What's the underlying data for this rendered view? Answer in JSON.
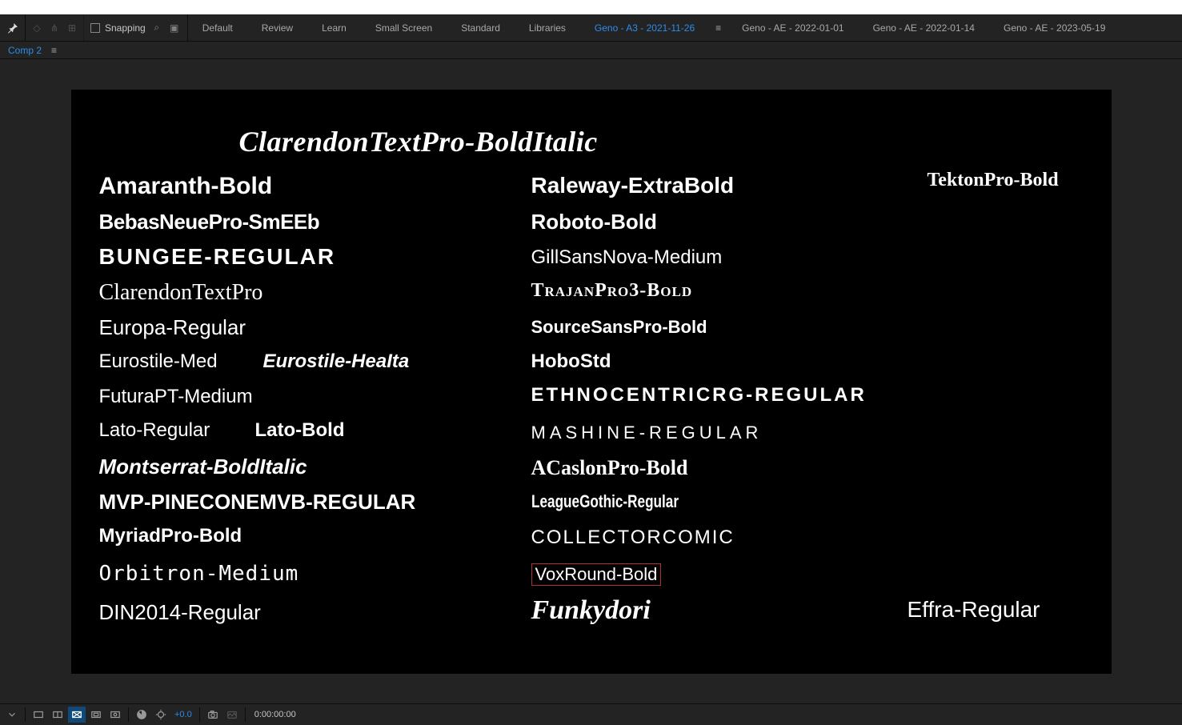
{
  "toolbar": {
    "snapping_label": "Snapping"
  },
  "workspaces": {
    "items": [
      {
        "label": "Default",
        "active": false
      },
      {
        "label": "Review",
        "active": false
      },
      {
        "label": "Learn",
        "active": false
      },
      {
        "label": "Small Screen",
        "active": false
      },
      {
        "label": "Standard",
        "active": false
      },
      {
        "label": "Libraries",
        "active": false
      },
      {
        "label": "Geno - A3 - 2021-11-26",
        "active": true
      },
      {
        "label": "Geno - AE - 2022-01-01",
        "active": false
      },
      {
        "label": "Geno - AE - 2022-01-14",
        "active": false
      },
      {
        "label": "Geno - AE - 2023-05-19",
        "active": false
      }
    ]
  },
  "tab": {
    "label": "Comp 2"
  },
  "canvas": {
    "title": "ClarendonTextPro-BoldItalic",
    "col1": {
      "amaranth": "Amaranth-Bold",
      "bebas": "BebasNeuePro-SmEEb",
      "bungee": "BUNGEE-REGULAR",
      "clarpro": "ClarendonTextPro",
      "europa": "Europa-Regular",
      "eur_med": "Eurostile-Med",
      "eur_hea": "Eurostile-HeaIta",
      "futura": "FuturaPT-Medium",
      "lato_r": "Lato-Regular",
      "lato_b": "Lato-Bold",
      "mont_bi": "Montserrat-BoldItalic",
      "mvp": "MVP-PINECONEMVB-REGULAR",
      "myriad": "MyriadPro-Bold",
      "orbitron": "Orbitron-Medium",
      "din": "DIN2014-Regular"
    },
    "col2": {
      "raleway": "Raleway-ExtraBold",
      "roboto": "Roboto-Bold",
      "gill": "GillSansNova-Medium",
      "trajan": "TrajanPro3-Bold",
      "ssp": "SourceSansPro-Bold",
      "hobo": "HoboStd",
      "ethno": "ETHNOCENTRICRG-REGULAR",
      "mashine": "MASHINE-REGULAR",
      "acaslon": "ACaslonPro-Bold",
      "league": "LeagueGothic-Regular",
      "collector": "COLLECTORCOMIC",
      "vox": "VoxRound-Bold",
      "funky": "Funkydori"
    },
    "col3": {
      "tekton": "TektonPro-Bold",
      "effra": "Effra-Regular"
    }
  },
  "footer": {
    "exposure": "+0.0",
    "time": "0:00:00:00"
  }
}
